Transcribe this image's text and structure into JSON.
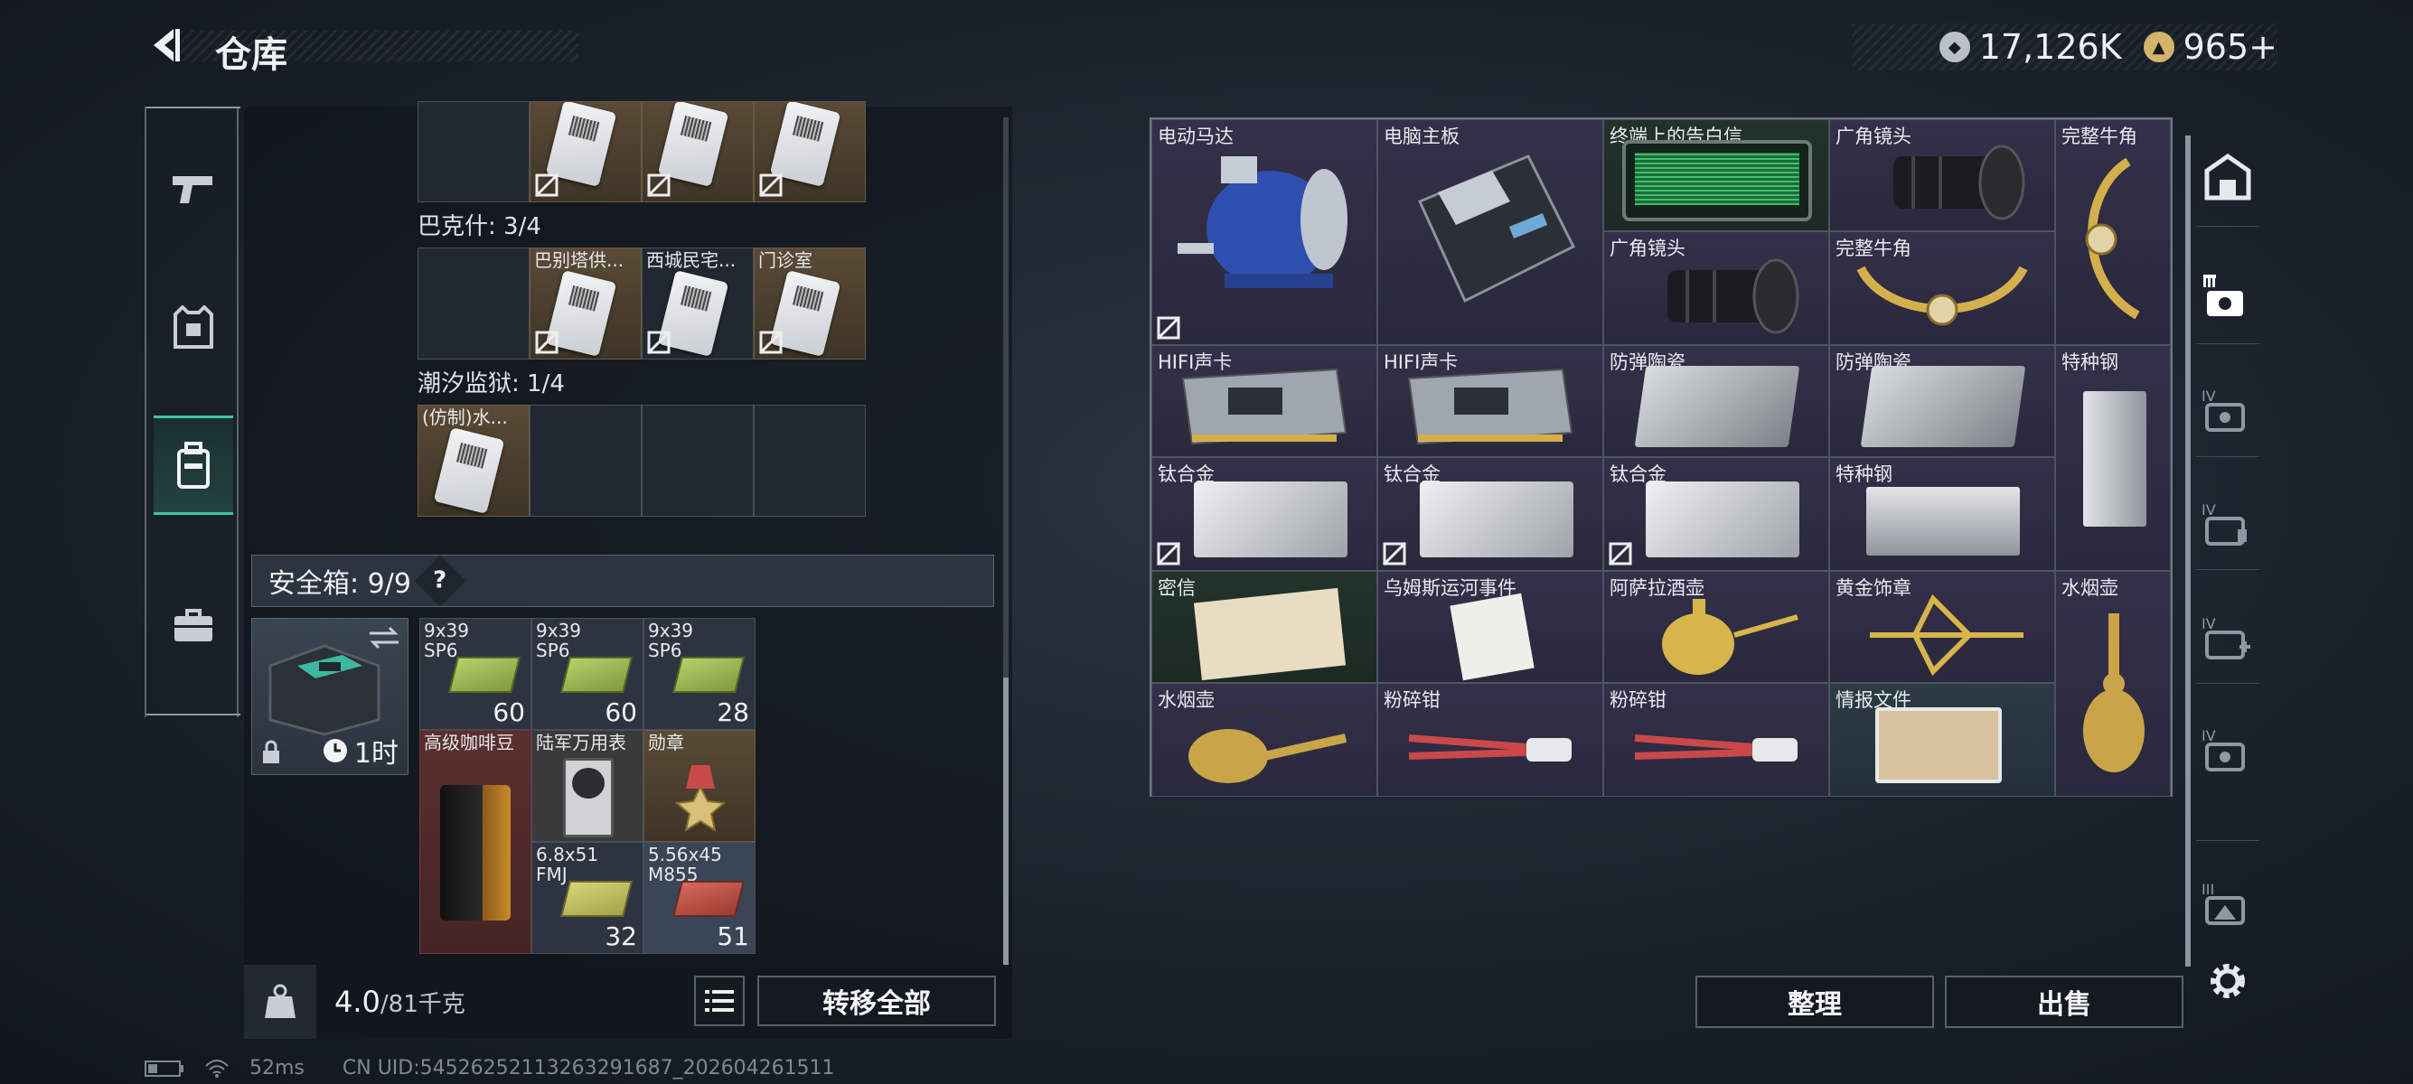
{
  "header": {
    "title": "仓库",
    "currency_1": "17,126K",
    "currency_2": "965+"
  },
  "left_rail": {
    "items": [
      "weapon",
      "armor",
      "backpack",
      "case"
    ]
  },
  "left_panel": {
    "group_bakeshi": "巴克什: 3/4",
    "group_chaoxi": "潮汐监狱: 1/4",
    "bakeshi_cards": [
      "巴别塔供...",
      "西城民宅...",
      "门诊室"
    ],
    "chaoxi_cards": [
      "(仿制)水..."
    ],
    "safebox_label": "安全箱: 9/9",
    "safebox_help": "?",
    "safebox_timer": "1时",
    "safe_items": [
      {
        "label": "9x39\nSP6",
        "count": "60"
      },
      {
        "label": "9x39\nSP6",
        "count": "60"
      },
      {
        "label": "9x39\nSP6",
        "count": "28"
      },
      {
        "label": "高级咖啡豆",
        "count": ""
      },
      {
        "label": "陆军万用表",
        "count": ""
      },
      {
        "label": "勋章",
        "count": ""
      },
      {
        "label": "6.8x51\nFMJ",
        "count": "32"
      },
      {
        "label": "5.56x45\nM855",
        "count": "51"
      }
    ],
    "weight": "4.0",
    "weight_max": "/81千克",
    "transfer_all": "转移全部"
  },
  "right_panel": {
    "items": [
      {
        "label": "电动马达"
      },
      {
        "label": "电脑主板"
      },
      {
        "label": "终端上的告白信"
      },
      {
        "label": "广角镜头"
      },
      {
        "label": "完整牛角"
      },
      {
        "label": "广角镜头"
      },
      {
        "label": "完整牛角"
      },
      {
        "label": "HIFI声卡"
      },
      {
        "label": "HIFI声卡"
      },
      {
        "label": "防弹陶瓷"
      },
      {
        "label": "防弹陶瓷"
      },
      {
        "label": "特种钢"
      },
      {
        "label": "钛合金"
      },
      {
        "label": "钛合金"
      },
      {
        "label": "钛合金"
      },
      {
        "label": "特种钢"
      },
      {
        "label": "密信"
      },
      {
        "label": "乌姆斯运河事件"
      },
      {
        "label": "阿萨拉酒壶"
      },
      {
        "label": "黄金饰章"
      },
      {
        "label": "水烟壶"
      },
      {
        "label": "水烟壶"
      },
      {
        "label": "粉碎钳"
      },
      {
        "label": "粉碎钳"
      },
      {
        "label": "情报文件"
      }
    ],
    "sort_button": "整理",
    "sell_button": "出售"
  },
  "status_bar": {
    "ping": "52ms",
    "uid": "CN UID:5452625211326329168​7_202604261511"
  },
  "colors": {
    "accent_green": "#3fc6a3",
    "gold_cell": "#5a4a36",
    "purple_cell": "#34304a"
  }
}
